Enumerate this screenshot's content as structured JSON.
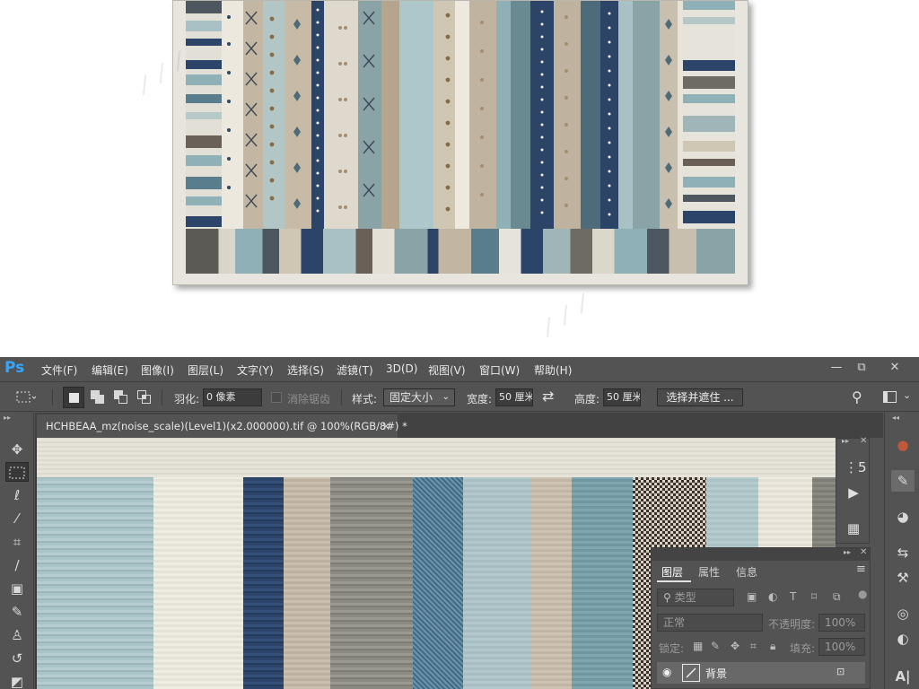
{
  "app": {
    "logo": "Ps",
    "menu": [
      "文件(F)",
      "编辑(E)",
      "图像(I)",
      "图层(L)",
      "文字(Y)",
      "选择(S)",
      "滤镜(T)",
      "3D(D)",
      "视图(V)",
      "窗口(W)",
      "帮助(H)"
    ],
    "window_buttons": [
      "—",
      "⧉",
      "✕"
    ]
  },
  "options": {
    "feather_label": "羽化:",
    "feather_value": "0 像素",
    "antialias_label": "消除锯齿",
    "style_label": "样式:",
    "style_value": "固定大小",
    "width_label": "宽度:",
    "width_value": "50 厘米",
    "height_label": "高度:",
    "height_value": "50 厘米",
    "select_mask_button": "选择并遮住 ..."
  },
  "document": {
    "tab_title": "HCHBEAA_mz(noise_scale)(Level1)(x2.000000).tif @ 100%(RGB/8#) *",
    "close": "×"
  },
  "layers_panel": {
    "tabs": [
      "图层",
      "属性",
      "信息"
    ],
    "filter_placeholder": "类型",
    "blend_mode": "正常",
    "opacity_label": "不透明度:",
    "opacity_value": "100%",
    "lock_label": "锁定:",
    "fill_label": "填充:",
    "fill_value": "100%",
    "layer_name": "背景"
  },
  "colors": {
    "ps_bg": "#535353",
    "ps_accent": "#31a8ff",
    "navy": "#2c4468",
    "teal": "#8fb0b6",
    "beige": "#c9bfae",
    "cream": "#efece3",
    "grey": "#8c8b83"
  }
}
